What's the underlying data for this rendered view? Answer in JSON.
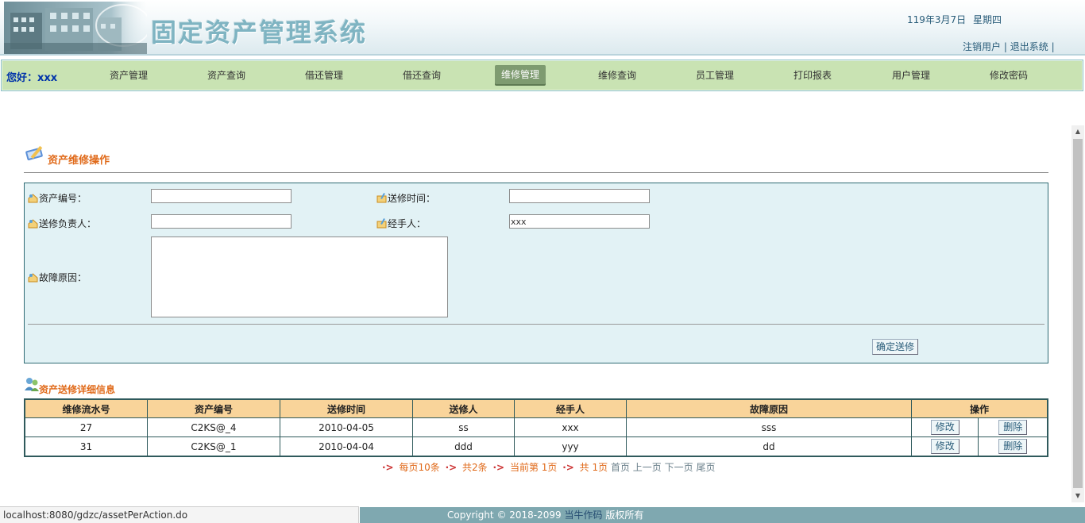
{
  "header": {
    "title": "固定资产管理系统",
    "date": "119年3月7日",
    "weekday": "星期四",
    "logout_user": "注销用户",
    "exit_system": "退出系统",
    "separator": "|"
  },
  "nav": {
    "greeting": "您好：xxx",
    "items": [
      {
        "label": "资产管理"
      },
      {
        "label": "资产查询"
      },
      {
        "label": "借还管理"
      },
      {
        "label": "借还查询"
      },
      {
        "label": "维修管理",
        "active": true
      },
      {
        "label": "维修查询"
      },
      {
        "label": "员工管理"
      },
      {
        "label": "打印报表"
      },
      {
        "label": "用户管理"
      },
      {
        "label": "修改密码"
      }
    ]
  },
  "section": {
    "title": "资产维修操作"
  },
  "form": {
    "asset_no_label": "资产编号：",
    "asset_no_value": "",
    "send_time_label": "送修时间：",
    "send_time_value": "",
    "responsible_label": "送修负责人：",
    "responsible_value": "",
    "handler_label": "经手人：",
    "handler_value": "xxx",
    "fault_label": "故障原因：",
    "fault_value": "",
    "submit_label": "确定送修"
  },
  "table": {
    "title": "资产送修详细信息",
    "columns": [
      "维修流水号",
      "资产编号",
      "送修时间",
      "送修人",
      "经手人",
      "故障原因",
      "操作"
    ],
    "rows": [
      {
        "id": "27",
        "asset_no": "C2KS@_4",
        "send_time": "2010-04-05",
        "sender": "ss",
        "handler": "xxx",
        "fault": "sss"
      },
      {
        "id": "31",
        "asset_no": "C2KS@_1",
        "send_time": "2010-04-04",
        "sender": "ddd",
        "handler": "yyy",
        "fault": "dd"
      }
    ],
    "edit_label": "修改",
    "delete_label": "删除"
  },
  "pager": {
    "per_page": "每页10条",
    "total": "共2条",
    "current": "当前第 1页",
    "pages": "共 1页",
    "first": "首页",
    "prev": "上一页",
    "next": "下一页",
    "last": "尾页"
  },
  "status_bar": {
    "url": "localhost:8080/gdzc/assetPerAction.do"
  },
  "footer": {
    "prefix": "Copyright © 2018-2099",
    "link": "当牛作码",
    "suffix": "版权所有"
  },
  "colors": {
    "nav_bg": "#c9e3b3",
    "nav_active": "#7e9b70",
    "title_orange": "#e06a1a",
    "panel_bg": "#e2f2f5",
    "table_header": "#f9d49a",
    "footer_bg": "#7fa8b0"
  }
}
